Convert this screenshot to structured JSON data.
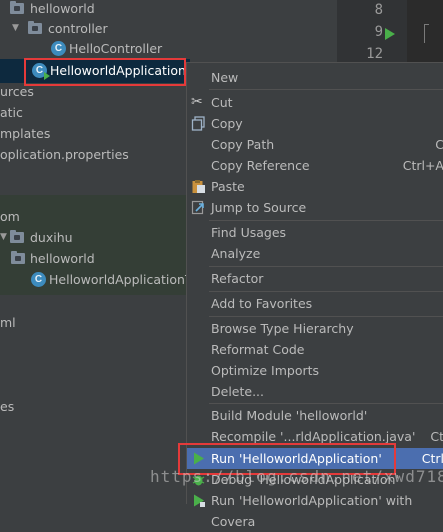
{
  "project_tree": {
    "items": [
      {
        "label": "helloworld"
      },
      {
        "label": "controller"
      },
      {
        "label": "HelloController"
      },
      {
        "label": "HelloworldApplication"
      },
      {
        "label": "urces"
      },
      {
        "label": "atic"
      },
      {
        "label": "mplates"
      },
      {
        "label": "oplication.properties"
      },
      {
        "label": "om"
      },
      {
        "label": "duxihu"
      },
      {
        "label": "helloworld"
      },
      {
        "label": "HelloworldApplicationTe"
      },
      {
        "label": "ml"
      },
      {
        "label": "es"
      }
    ]
  },
  "editor": {
    "line_numbers": [
      "8",
      "9",
      "12"
    ]
  },
  "context_menu": {
    "items": [
      {
        "label": "New",
        "shortcut": ""
      },
      {
        "label": "Cut",
        "shortcut": ""
      },
      {
        "label": "Copy",
        "shortcut": ""
      },
      {
        "label": "Copy Path",
        "shortcut": "C"
      },
      {
        "label": "Copy Reference",
        "shortcut": "Ctrl+A"
      },
      {
        "label": "Paste",
        "shortcut": ""
      },
      {
        "label": "Jump to Source",
        "shortcut": ""
      },
      {
        "label": "Find Usages",
        "shortcut": ""
      },
      {
        "label": "Analyze",
        "shortcut": ""
      },
      {
        "label": "Refactor",
        "shortcut": ""
      },
      {
        "label": "Add to Favorites",
        "shortcut": ""
      },
      {
        "label": "Browse Type Hierarchy",
        "shortcut": ""
      },
      {
        "label": "Reformat Code",
        "shortcut": ""
      },
      {
        "label": "Optimize Imports",
        "shortcut": ""
      },
      {
        "label": "Delete...",
        "shortcut": ""
      },
      {
        "label": "Build Module 'helloworld'",
        "shortcut": ""
      },
      {
        "label": "Recompile '...rldApplication.java'",
        "shortcut": "Ct"
      },
      {
        "label": "Run 'HelloworldApplication'",
        "shortcut": "Ctrl"
      },
      {
        "label": "Debug 'HelloworldApplication'",
        "shortcut": ""
      },
      {
        "label": "Run 'HelloworldApplication' with Covera",
        "shortcut": ""
      }
    ]
  },
  "watermark": "https://blog.csdn.net/xwd718",
  "colors": {
    "background": "#3c3f41",
    "selection": "#4b6eaf",
    "highlight_box": "#e43a3a",
    "run_green": "#4ab04a"
  }
}
